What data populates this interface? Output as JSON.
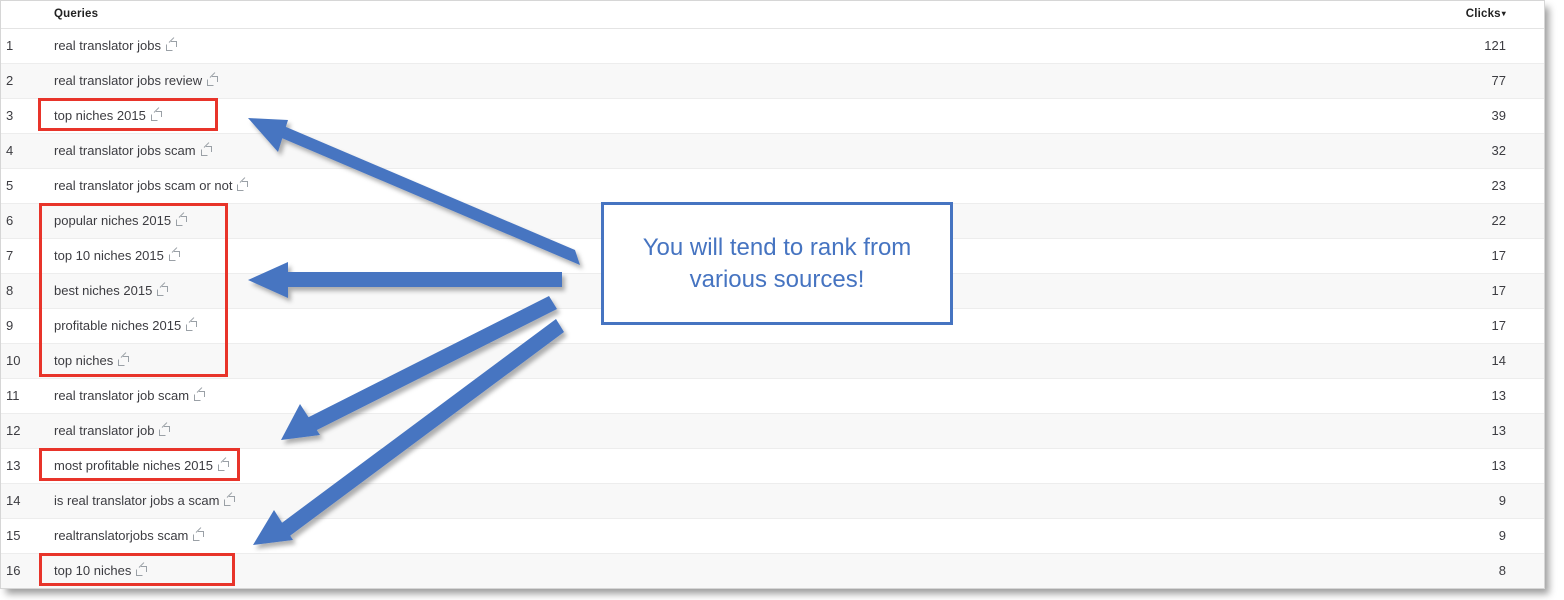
{
  "table": {
    "columns": {
      "index": "",
      "queries": "Queries",
      "clicks": "Clicks",
      "clicks_sort_caret": "▾"
    },
    "rows": [
      {
        "index": "1",
        "query": "real translator jobs",
        "clicks": "121"
      },
      {
        "index": "2",
        "query": "real translator jobs review",
        "clicks": "77"
      },
      {
        "index": "3",
        "query": "top niches 2015",
        "clicks": "39"
      },
      {
        "index": "4",
        "query": "real translator jobs scam",
        "clicks": "32"
      },
      {
        "index": "5",
        "query": "real translator jobs scam or not",
        "clicks": "23"
      },
      {
        "index": "6",
        "query": "popular niches 2015",
        "clicks": "22"
      },
      {
        "index": "7",
        "query": "top 10 niches 2015",
        "clicks": "17"
      },
      {
        "index": "8",
        "query": "best niches 2015",
        "clicks": "17"
      },
      {
        "index": "9",
        "query": "profitable niches 2015",
        "clicks": "17"
      },
      {
        "index": "10",
        "query": "top niches",
        "clicks": "14"
      },
      {
        "index": "11",
        "query": "real translator job scam",
        "clicks": "13"
      },
      {
        "index": "12",
        "query": "real translator job",
        "clicks": "13"
      },
      {
        "index": "13",
        "query": "most profitable niches 2015",
        "clicks": "13"
      },
      {
        "index": "14",
        "query": "is real translator jobs a scam",
        "clicks": "9"
      },
      {
        "index": "15",
        "query": "realtranslatorjobs scam",
        "clicks": "9"
      },
      {
        "index": "16",
        "query": "top 10 niches",
        "clicks": "8"
      }
    ]
  },
  "annotations": {
    "callout": {
      "text": "You will tend to rank from various sources!",
      "border_color": "#4674c1",
      "text_color": "#4674c1"
    },
    "highlight_color": "#e8342a",
    "arrow_color": "#4674c1",
    "highlights": [
      {
        "label": "top niches 2015"
      },
      {
        "label": "popular niches 2015 / top 10 niches 2015 / best niches 2015 / profitable niches 2015 / top niches"
      },
      {
        "label": "most profitable niches 2015"
      },
      {
        "label": "top 10 niches"
      }
    ],
    "arrows": [
      {
        "label": "arrow-to-top-niches-2015"
      },
      {
        "label": "arrow-to-niches-group"
      },
      {
        "label": "arrow-to-most-profitable-niches-2015"
      },
      {
        "label": "arrow-to-top-10-niches"
      }
    ]
  },
  "icons": {
    "external_link": "external-link-icon"
  }
}
